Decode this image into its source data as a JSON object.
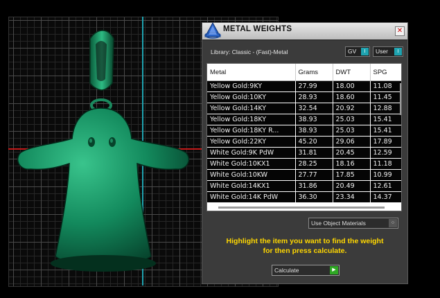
{
  "dialog": {
    "title": "METAL WEIGHTS",
    "close_glyph": "✕",
    "library_label": "Library: Classic - (Fast)-Metal",
    "gv_toggle": {
      "label": "GV",
      "knob": "I"
    },
    "user_toggle": {
      "label": "User",
      "knob": "I"
    },
    "table": {
      "headers": [
        "Metal",
        "Grams",
        "DWT",
        "SPG"
      ],
      "rows": [
        [
          "Yellow Gold:9KY",
          "27.99",
          "18.00",
          "11.08"
        ],
        [
          "Yellow Gold:10KY",
          "28.93",
          "18.60",
          "11.45"
        ],
        [
          "Yellow Gold:14KY",
          "32.54",
          "20.92",
          "12.88"
        ],
        [
          "Yellow Gold:18KY",
          "38.93",
          "25.03",
          "15.41"
        ],
        [
          "Yellow Gold:18KY R...",
          "38.93",
          "25.03",
          "15.41"
        ],
        [
          "Yellow Gold:22KY",
          "45.20",
          "29.06",
          "17.89"
        ],
        [
          "White Gold:9K PdW",
          "31.81",
          "20.45",
          "12.59"
        ],
        [
          "White Gold:10KX1",
          "28.25",
          "18.16",
          "11.18"
        ],
        [
          "White Gold:10KW",
          "27.77",
          "17.85",
          "10.99"
        ],
        [
          "White Gold:14KX1",
          "31.86",
          "20.49",
          "12.61"
        ],
        [
          "White Gold:14K PdW",
          "36.30",
          "23.34",
          "14.37"
        ]
      ]
    },
    "material_dropdown": {
      "label": "Use Object Materials",
      "arrow": "○"
    },
    "hint_line1": "Highlight the item you want to find the weight",
    "hint_line2": "for then press calculate.",
    "calculate_button": {
      "label": "Calculate",
      "arrow": "▶"
    }
  },
  "viewport": {
    "model_color": "#1a8a5e",
    "x_axis_color": "#c41a1a",
    "y_axis_color": "#1fa3b0"
  },
  "colors": {
    "hint_text": "#ffd700",
    "dialog_bg": "#3b3b3b",
    "table_row_bg": "#050505"
  },
  "icons": [
    "app-logo-icon",
    "close-icon",
    "toggle-knob-icon",
    "dropdown-arrow-icon",
    "play-arrow-icon"
  ]
}
